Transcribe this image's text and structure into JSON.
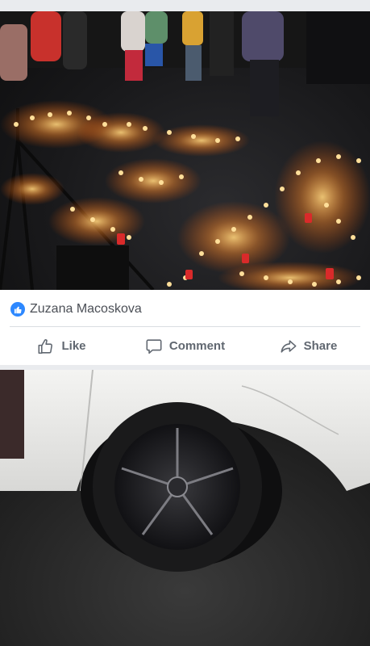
{
  "post": {
    "liker_name": "Zuzana Macoskova",
    "actions": {
      "like": "Like",
      "comment": "Comment",
      "share": "Share"
    }
  },
  "icons": {
    "reaction": "like-reaction-icon",
    "like": "thumbs-up-icon",
    "comment": "speech-bubble-icon",
    "share": "share-arrow-icon"
  },
  "colors": {
    "reaction_blue": "#2d88ff",
    "action_text": "#606770",
    "name_text": "#4b4f56",
    "separator": "#e9ebee"
  }
}
